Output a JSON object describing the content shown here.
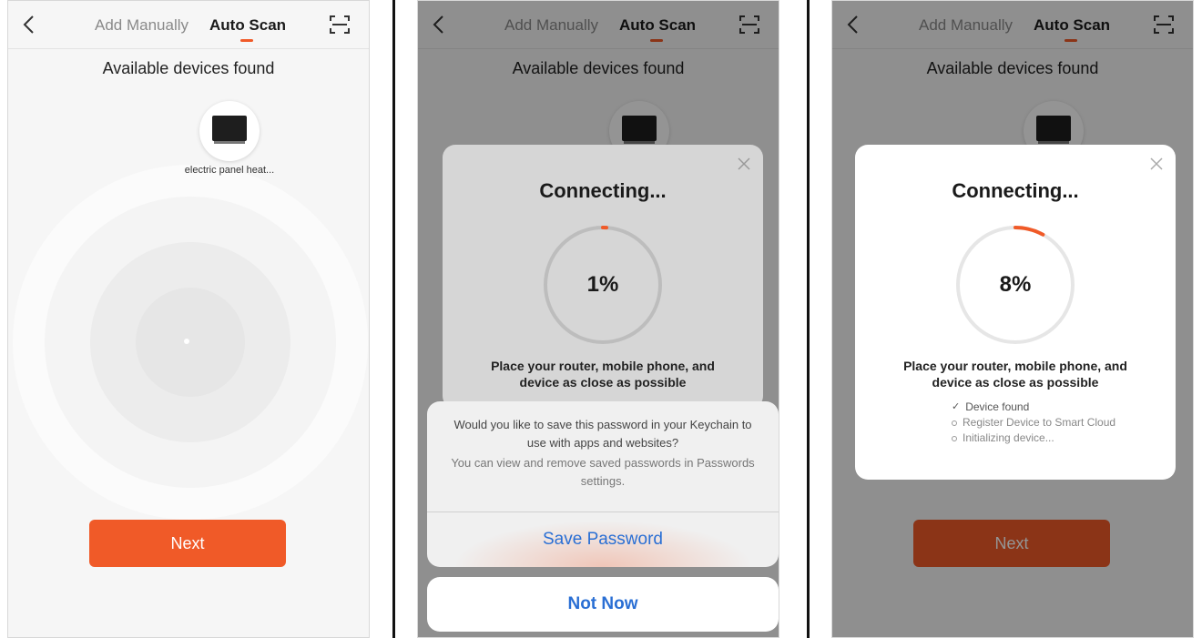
{
  "colors": {
    "accent": "#f05a28",
    "link": "#2a6fd4"
  },
  "header": {
    "tabs": [
      {
        "label": "Add Manually",
        "active": false
      },
      {
        "label": "Auto Scan",
        "active": true
      }
    ],
    "back_icon": "chevron-left-icon",
    "scan_icon": "scan-frame-icon"
  },
  "screen1": {
    "title": "Available devices found",
    "device": {
      "label": "electric panel heat...",
      "icon": "tv-panel-icon"
    },
    "next_label": "Next"
  },
  "screen2": {
    "title": "Available devices found",
    "modal": {
      "title": "Connecting...",
      "progress_percent": 1,
      "progress_text": "1%",
      "hint": "Place your router, mobile phone, and device as close as possible"
    },
    "keychain": {
      "question": "Would you like to save this password in your Keychain to use with apps and websites?",
      "sub": "You can view and remove saved passwords in Passwords settings.",
      "save_label": "Save Password",
      "not_now_label": "Not Now"
    }
  },
  "screen3": {
    "title": "Available devices found",
    "modal": {
      "title": "Connecting...",
      "progress_percent": 8,
      "progress_text": "8%",
      "hint": "Place your router, mobile phone, and device as close as possible",
      "steps": [
        {
          "label": "Device found",
          "done": true
        },
        {
          "label": "Register Device to Smart Cloud",
          "done": false
        },
        {
          "label": "Initializing device...",
          "done": false
        }
      ]
    },
    "next_label": "Next"
  }
}
